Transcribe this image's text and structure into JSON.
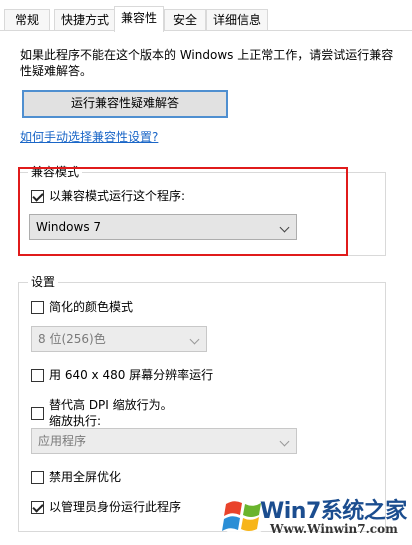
{
  "tabs": [
    {
      "label": "常规",
      "active": false
    },
    {
      "label": "快捷方式",
      "active": false
    },
    {
      "label": "兼容性",
      "active": true
    },
    {
      "label": "安全",
      "active": false
    },
    {
      "label": "详细信息",
      "active": false
    }
  ],
  "intro_text": "如果此程序不能在这个版本的 Windows 上正常工作，请尝试运行兼容性疑难解答。",
  "run_troubleshooter_label": "运行兼容性疑难解答",
  "manual_link_label": "如何手动选择兼容性设置?",
  "compat_mode": {
    "group_title": "兼容模式",
    "checkbox_label": "以兼容模式运行这个程序:",
    "checked": true,
    "selected_os": "Windows 7"
  },
  "settings": {
    "group_title": "设置",
    "reduced_color_label": "简化的颜色模式",
    "reduced_color_checked": false,
    "color_select_value": "8 位(256)色",
    "res_640_label": "用 640 x 480 屏幕分辨率运行",
    "res_640_checked": false,
    "dpi_label_line1": "替代高 DPI 缩放行为。",
    "dpi_label_line2": "缩放执行:",
    "dpi_checked": false,
    "dpi_select_value": "应用程序",
    "disable_fullscreen_label": "禁用全屏优化",
    "disable_fullscreen_checked": false,
    "run_as_admin_label": "以管理员身份运行此程序",
    "run_as_admin_checked": true
  },
  "watermark": {
    "brand": "Win7系统之家",
    "url": "Www.Winwin7.com"
  },
  "colors": {
    "link": "#1a66c7",
    "highlight_border": "#e01b1b",
    "button_border": "#4f8fd0"
  }
}
